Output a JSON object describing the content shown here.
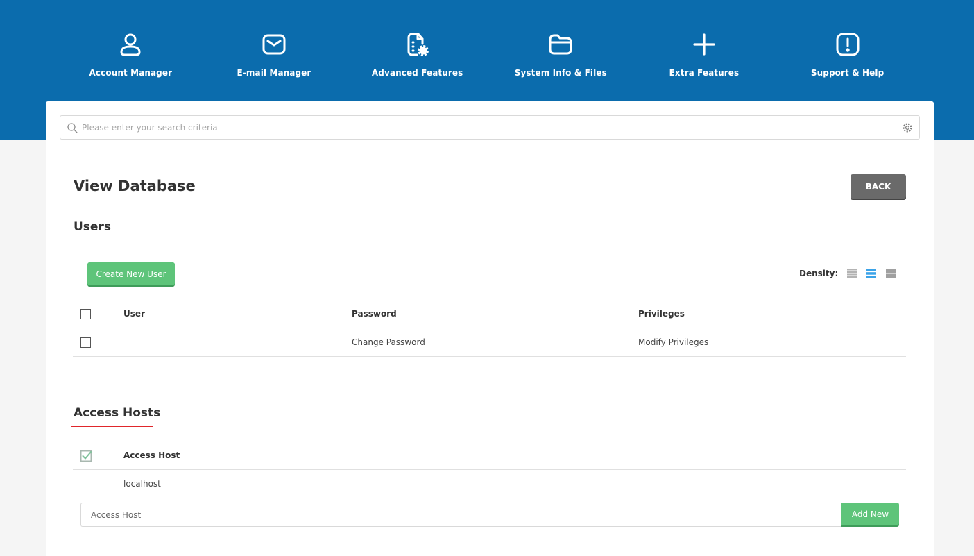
{
  "nav": [
    {
      "label": "Account Manager",
      "icon": "user-icon"
    },
    {
      "label": "E-mail Manager",
      "icon": "envelope-icon"
    },
    {
      "label": "Advanced Features",
      "icon": "document-gear-icon"
    },
    {
      "label": "System Info & Files",
      "icon": "folder-icon"
    },
    {
      "label": "Extra Features",
      "icon": "plus-icon"
    },
    {
      "label": "Support & Help",
      "icon": "alert-icon"
    }
  ],
  "search": {
    "placeholder": "Please enter your search criteria",
    "value": ""
  },
  "page": {
    "title": "View Database",
    "back_label": "BACK"
  },
  "users": {
    "title": "Users",
    "create_label": "Create New User",
    "density_label": "Density:",
    "density_selected": "medium",
    "columns": {
      "user": "User",
      "password": "Password",
      "privileges": "Privileges"
    },
    "rows": [
      {
        "user": "",
        "password": "Change Password",
        "privileges": "Modify Privileges"
      }
    ]
  },
  "hosts": {
    "title": "Access Hosts",
    "column": "Access Host",
    "rows": [
      {
        "host": "localhost"
      }
    ],
    "input_placeholder": "Access Host",
    "add_label": "Add New"
  },
  "colors": {
    "header_blue": "#0b6cad",
    "green": "#5ec47a",
    "back_gray": "#6a6a6a",
    "accent_red": "#e0262b",
    "density_active": "#3ba3e8"
  }
}
